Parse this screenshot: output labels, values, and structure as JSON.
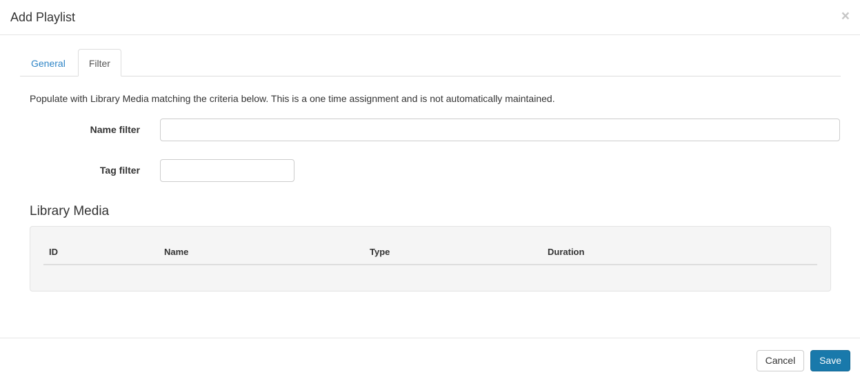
{
  "modal": {
    "title": "Add Playlist",
    "close_icon": "×"
  },
  "tabs": [
    {
      "label": "General",
      "active": false
    },
    {
      "label": "Filter",
      "active": true
    }
  ],
  "filter_tab": {
    "description": "Populate with Library Media matching the criteria below. This is a one time assignment and is not automatically maintained.",
    "fields": [
      {
        "label": "Name filter",
        "value": ""
      },
      {
        "label": "Tag filter",
        "value": ""
      }
    ]
  },
  "library_media": {
    "heading": "Library Media",
    "columns": [
      "ID",
      "Name",
      "Type",
      "Duration"
    ],
    "rows": []
  },
  "footer": {
    "cancel_label": "Cancel",
    "save_label": "Save"
  },
  "colors": {
    "save_button": "#1979ab",
    "inactive_tab_link": "#2d84c6",
    "active_tab_text": "#555555",
    "well_background": "#f5f5f5",
    "divider": "#e5e5e5"
  }
}
